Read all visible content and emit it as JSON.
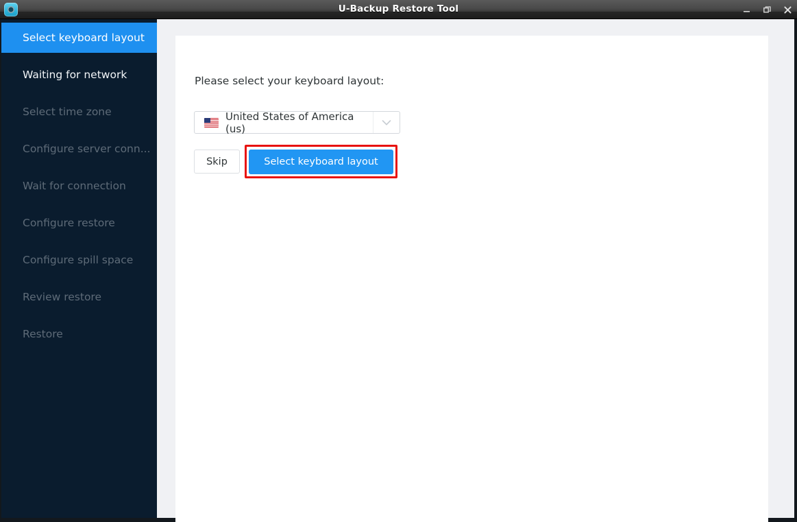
{
  "window": {
    "title": "U-Backup Restore Tool",
    "app_icon": "backup-disc-icon",
    "controls": [
      {
        "name": "minimize-button",
        "glyph": "minimize-icon"
      },
      {
        "name": "maximize-button",
        "glyph": "maximize-icon"
      },
      {
        "name": "close-button",
        "glyph": "close-icon"
      }
    ]
  },
  "sidebar": {
    "items": [
      {
        "label": "Select keyboard layout",
        "state": "active"
      },
      {
        "label": "Waiting for network",
        "state": "current"
      },
      {
        "label": "Select time zone",
        "state": "pending"
      },
      {
        "label": "Configure server conn...",
        "state": "pending"
      },
      {
        "label": "Wait for connection",
        "state": "pending"
      },
      {
        "label": "Configure restore",
        "state": "pending"
      },
      {
        "label": "Configure spill space",
        "state": "pending"
      },
      {
        "label": "Review restore",
        "state": "pending"
      },
      {
        "label": "Restore",
        "state": "pending"
      }
    ]
  },
  "main": {
    "prompt": "Please select your keyboard layout:",
    "keyboard_select": {
      "value": "United States of America (us)",
      "flag": "us-flag-icon",
      "arrow": "chevron-down-icon"
    },
    "buttons": {
      "skip": "Skip",
      "primary": "Select keyboard layout"
    }
  },
  "colors": {
    "accent_blue": "#2196f3",
    "sidebar_bg": "#0a1c2e",
    "sidebar_active": "#1e90f0",
    "highlight_red": "#e8120f",
    "panel_bg": "#ffffff",
    "content_bg": "#f0f1f4"
  }
}
